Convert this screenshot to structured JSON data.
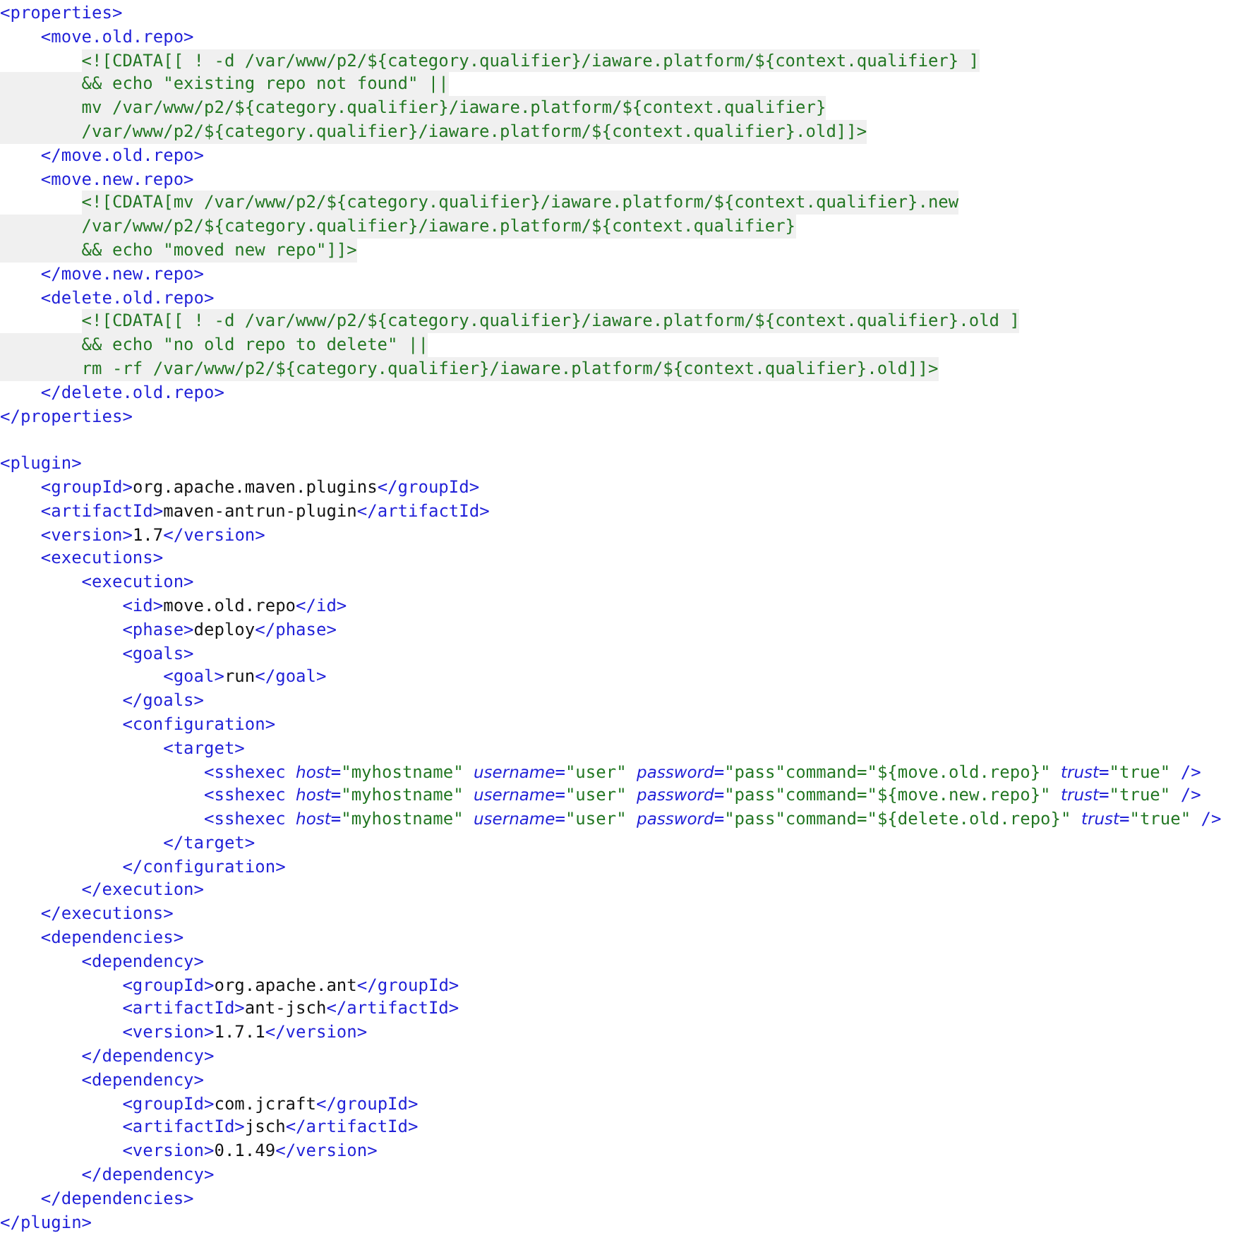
{
  "blocks": [
    {
      "lines": [
        {
          "tokens": [
            {
              "kind": "tag",
              "text": "<properties>"
            }
          ]
        },
        {
          "tokens": [
            {
              "kind": "tag",
              "text": "    <move.old.repo>"
            }
          ]
        },
        {
          "tokens": [
            {
              "kind": "cdata",
              "text": "        <![CDATA[[ ! -d /var/www/p2/${category.qualifier}/iaware.platform/${context.qualifier} ]"
            }
          ]
        },
        {
          "tokens": [
            {
              "kind": "cdata_more",
              "text": "        && echo \"existing repo not found\" ||"
            }
          ]
        },
        {
          "tokens": [
            {
              "kind": "cdata_more",
              "text": "        mv /var/www/p2/${category.qualifier}/iaware.platform/${context.qualifier}"
            }
          ]
        },
        {
          "tokens": [
            {
              "kind": "cdata_more",
              "text": "        /var/www/p2/${category.qualifier}/iaware.platform/${context.qualifier}.old]]>"
            }
          ]
        },
        {
          "tokens": [
            {
              "kind": "tag",
              "text": "    </move.old.repo>"
            }
          ]
        },
        {
          "tokens": [
            {
              "kind": "tag",
              "text": "    <move.new.repo>"
            }
          ]
        },
        {
          "tokens": [
            {
              "kind": "cdata",
              "text": "        <![CDATA[mv /var/www/p2/${category.qualifier}/iaware.platform/${context.qualifier}.new"
            }
          ]
        },
        {
          "tokens": [
            {
              "kind": "cdata_more",
              "text": "        /var/www/p2/${category.qualifier}/iaware.platform/${context.qualifier}"
            }
          ]
        },
        {
          "tokens": [
            {
              "kind": "cdata_more",
              "text": "        && echo \"moved new repo\"]]>"
            }
          ]
        },
        {
          "tokens": [
            {
              "kind": "tag",
              "text": "    </move.new.repo>"
            }
          ]
        },
        {
          "tokens": [
            {
              "kind": "tag",
              "text": "    <delete.old.repo>"
            }
          ]
        },
        {
          "tokens": [
            {
              "kind": "cdata",
              "text": "        <![CDATA[[ ! -d /var/www/p2/${category.qualifier}/iaware.platform/${context.qualifier}.old ]"
            }
          ]
        },
        {
          "tokens": [
            {
              "kind": "cdata_more",
              "text": "        && echo \"no old repo to delete\" ||"
            }
          ]
        },
        {
          "tokens": [
            {
              "kind": "cdata_more",
              "text": "        rm -rf /var/www/p2/${category.qualifier}/iaware.platform/${context.qualifier}.old]]>"
            }
          ]
        },
        {
          "tokens": [
            {
              "kind": "tag",
              "text": "    </delete.old.repo>"
            }
          ]
        },
        {
          "tokens": [
            {
              "kind": "tag",
              "text": "</properties>"
            }
          ]
        }
      ]
    },
    {
      "lines": [
        {
          "tokens": [
            {
              "kind": "tag",
              "text": "<plugin>"
            }
          ]
        },
        {
          "tokens": [
            {
              "kind": "tag",
              "text": "    <groupId>"
            },
            {
              "kind": "text",
              "text": "org.apache.maven.plugins"
            },
            {
              "kind": "tag",
              "text": "</groupId>"
            }
          ]
        },
        {
          "tokens": [
            {
              "kind": "tag",
              "text": "    <artifactId>"
            },
            {
              "kind": "text",
              "text": "maven-antrun-plugin"
            },
            {
              "kind": "tag",
              "text": "</artifactId>"
            }
          ]
        },
        {
          "tokens": [
            {
              "kind": "tag",
              "text": "    <version>"
            },
            {
              "kind": "text",
              "text": "1.7"
            },
            {
              "kind": "tag",
              "text": "</version>"
            }
          ]
        },
        {
          "tokens": [
            {
              "kind": "tag",
              "text": "    <executions>"
            }
          ]
        },
        {
          "tokens": [
            {
              "kind": "tag",
              "text": "        <execution>"
            }
          ]
        },
        {
          "tokens": [
            {
              "kind": "tag",
              "text": "            <id>"
            },
            {
              "kind": "text",
              "text": "move.old.repo"
            },
            {
              "kind": "tag",
              "text": "</id>"
            }
          ]
        },
        {
          "tokens": [
            {
              "kind": "tag",
              "text": "            <phase>"
            },
            {
              "kind": "text",
              "text": "deploy"
            },
            {
              "kind": "tag",
              "text": "</phase>"
            }
          ]
        },
        {
          "tokens": [
            {
              "kind": "tag",
              "text": "            <goals>"
            }
          ]
        },
        {
          "tokens": [
            {
              "kind": "tag",
              "text": "                <goal>"
            },
            {
              "kind": "text",
              "text": "run"
            },
            {
              "kind": "tag",
              "text": "</goal>"
            }
          ]
        },
        {
          "tokens": [
            {
              "kind": "tag",
              "text": "            </goals>"
            }
          ]
        },
        {
          "tokens": [
            {
              "kind": "tag",
              "text": "            <configuration>"
            }
          ]
        },
        {
          "tokens": [
            {
              "kind": "tag",
              "text": "                <target>"
            }
          ]
        },
        {
          "tokens": [
            {
              "kind": "tag",
              "text": "                    <sshexec "
            },
            {
              "kind": "attr",
              "text": "host"
            },
            {
              "kind": "tag",
              "text": "="
            },
            {
              "kind": "value",
              "text": "\"myhostname\" "
            },
            {
              "kind": "attr",
              "text": "username"
            },
            {
              "kind": "tag",
              "text": "="
            },
            {
              "kind": "value",
              "text": "\"user\" "
            },
            {
              "kind": "attr",
              "text": "password"
            },
            {
              "kind": "tag",
              "text": "="
            },
            {
              "kind": "value",
              "text": "\"pass\"command=\"${move.old.repo}\" "
            },
            {
              "kind": "attr",
              "text": "trust"
            },
            {
              "kind": "tag",
              "text": "="
            },
            {
              "kind": "value",
              "text": "\"true\" "
            },
            {
              "kind": "tag",
              "text": "/>"
            }
          ]
        },
        {
          "tokens": [
            {
              "kind": "tag",
              "text": "                    <sshexec "
            },
            {
              "kind": "attr",
              "text": "host"
            },
            {
              "kind": "tag",
              "text": "="
            },
            {
              "kind": "value",
              "text": "\"myhostname\" "
            },
            {
              "kind": "attr",
              "text": "username"
            },
            {
              "kind": "tag",
              "text": "="
            },
            {
              "kind": "value",
              "text": "\"user\" "
            },
            {
              "kind": "attr",
              "text": "password"
            },
            {
              "kind": "tag",
              "text": "="
            },
            {
              "kind": "value",
              "text": "\"pass\"command=\"${move.new.repo}\" "
            },
            {
              "kind": "attr",
              "text": "trust"
            },
            {
              "kind": "tag",
              "text": "="
            },
            {
              "kind": "value",
              "text": "\"true\" "
            },
            {
              "kind": "tag",
              "text": "/>"
            }
          ]
        },
        {
          "tokens": [
            {
              "kind": "tag",
              "text": "                    <sshexec "
            },
            {
              "kind": "attr",
              "text": "host"
            },
            {
              "kind": "tag",
              "text": "="
            },
            {
              "kind": "value",
              "text": "\"myhostname\" "
            },
            {
              "kind": "attr",
              "text": "username"
            },
            {
              "kind": "tag",
              "text": "="
            },
            {
              "kind": "value",
              "text": "\"user\" "
            },
            {
              "kind": "attr",
              "text": "password"
            },
            {
              "kind": "tag",
              "text": "="
            },
            {
              "kind": "value",
              "text": "\"pass\"command=\"${delete.old.repo}\" "
            },
            {
              "kind": "attr",
              "text": "trust"
            },
            {
              "kind": "tag",
              "text": "="
            },
            {
              "kind": "value",
              "text": "\"true\" "
            },
            {
              "kind": "tag",
              "text": "/>"
            }
          ]
        },
        {
          "tokens": [
            {
              "kind": "tag",
              "text": "                </target>"
            }
          ]
        },
        {
          "tokens": [
            {
              "kind": "tag",
              "text": "            </configuration>"
            }
          ]
        },
        {
          "tokens": [
            {
              "kind": "tag",
              "text": "        </execution>"
            }
          ]
        },
        {
          "tokens": [
            {
              "kind": "tag",
              "text": "    </executions>"
            }
          ]
        },
        {
          "tokens": [
            {
              "kind": "tag",
              "text": "    <dependencies>"
            }
          ]
        },
        {
          "tokens": [
            {
              "kind": "tag",
              "text": "        <dependency>"
            }
          ]
        },
        {
          "tokens": [
            {
              "kind": "tag",
              "text": "            <groupId>"
            },
            {
              "kind": "text",
              "text": "org.apache.ant"
            },
            {
              "kind": "tag",
              "text": "</groupId>"
            }
          ]
        },
        {
          "tokens": [
            {
              "kind": "tag",
              "text": "            <artifactId>"
            },
            {
              "kind": "text",
              "text": "ant-jsch"
            },
            {
              "kind": "tag",
              "text": "</artifactId>"
            }
          ]
        },
        {
          "tokens": [
            {
              "kind": "tag",
              "text": "            <version>"
            },
            {
              "kind": "text",
              "text": "1.7.1"
            },
            {
              "kind": "tag",
              "text": "</version>"
            }
          ]
        },
        {
          "tokens": [
            {
              "kind": "tag",
              "text": "        </dependency>"
            }
          ]
        },
        {
          "tokens": [
            {
              "kind": "tag",
              "text": "        <dependency>"
            }
          ]
        },
        {
          "tokens": [
            {
              "kind": "tag",
              "text": "            <groupId>"
            },
            {
              "kind": "text",
              "text": "com.jcraft"
            },
            {
              "kind": "tag",
              "text": "</groupId>"
            }
          ]
        },
        {
          "tokens": [
            {
              "kind": "tag",
              "text": "            <artifactId>"
            },
            {
              "kind": "text",
              "text": "jsch"
            },
            {
              "kind": "tag",
              "text": "</artifactId>"
            }
          ]
        },
        {
          "tokens": [
            {
              "kind": "tag",
              "text": "            <version>"
            },
            {
              "kind": "text",
              "text": "0.1.49"
            },
            {
              "kind": "tag",
              "text": "</version>"
            }
          ]
        },
        {
          "tokens": [
            {
              "kind": "tag",
              "text": "        </dependency>"
            }
          ]
        },
        {
          "tokens": [
            {
              "kind": "tag",
              "text": "    </dependencies>"
            }
          ]
        },
        {
          "tokens": [
            {
              "kind": "tag",
              "text": "</plugin>"
            }
          ]
        }
      ]
    }
  ]
}
